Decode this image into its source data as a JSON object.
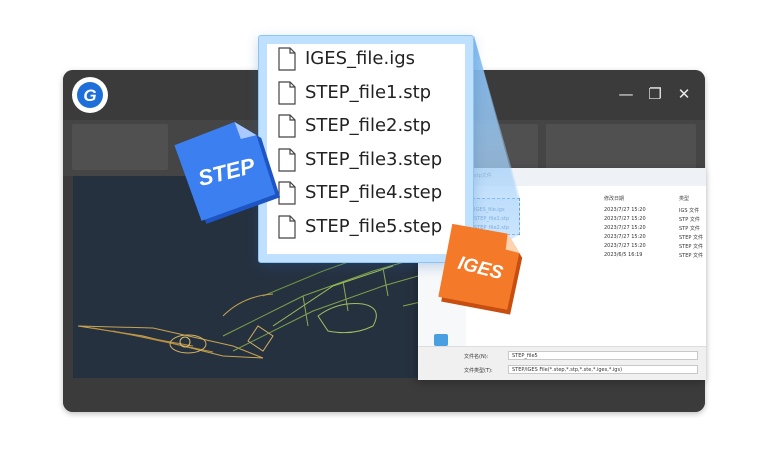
{
  "app": {
    "logo_letter": "G",
    "accent": "#1e6fd9",
    "window_controls": {
      "minimize": "—",
      "restore": "❐",
      "close": "✕"
    }
  },
  "file_popup": {
    "files": [
      {
        "name": "IGES_file.igs",
        "icon": "document-icon"
      },
      {
        "name": "STEP_file1.stp",
        "icon": "document-icon"
      },
      {
        "name": "STEP_file2.stp",
        "icon": "document-icon"
      },
      {
        "name": "STEP_file3.step",
        "icon": "document-icon"
      },
      {
        "name": "STEP_file4.step",
        "icon": "document-icon"
      },
      {
        "name": "STEP_file5.step",
        "icon": "document-icon"
      }
    ]
  },
  "badges": {
    "step": {
      "label": "STEP",
      "color": "#2d6fe0"
    },
    "iges": {
      "label": "IGES",
      "color": "#f06a1e"
    }
  },
  "dialog": {
    "breadcrumb": "stp文件",
    "columns": {
      "date": "修改日期",
      "type": "类型"
    },
    "rows": [
      {
        "name": "IGES_file.igs",
        "date": "2023/7/27 15:20",
        "type": "IGS 文件"
      },
      {
        "name": "STEP_file1.stp",
        "date": "2023/7/27 15:20",
        "type": "STP 文件"
      },
      {
        "name": "STEP_file2.stp",
        "date": "2023/7/27 15:20",
        "type": "STP 文件"
      },
      {
        "name": "",
        "date": "2023/7/27 15:20",
        "type": "STEP 文件"
      },
      {
        "name": "",
        "date": "2023/7/27 15:20",
        "type": "STEP 文件"
      },
      {
        "name": "",
        "date": "2023/6/5 16:19",
        "type": "STEP 文件"
      }
    ],
    "sidebar_network": "网络",
    "filename_label": "文件名(N):",
    "filename_value": "STEP_file5",
    "filetype_label": "文件类型(T):",
    "filetype_value": "STEP/IGES File(*.step,*.stp,*.ste,*.iges,*.igs)"
  }
}
